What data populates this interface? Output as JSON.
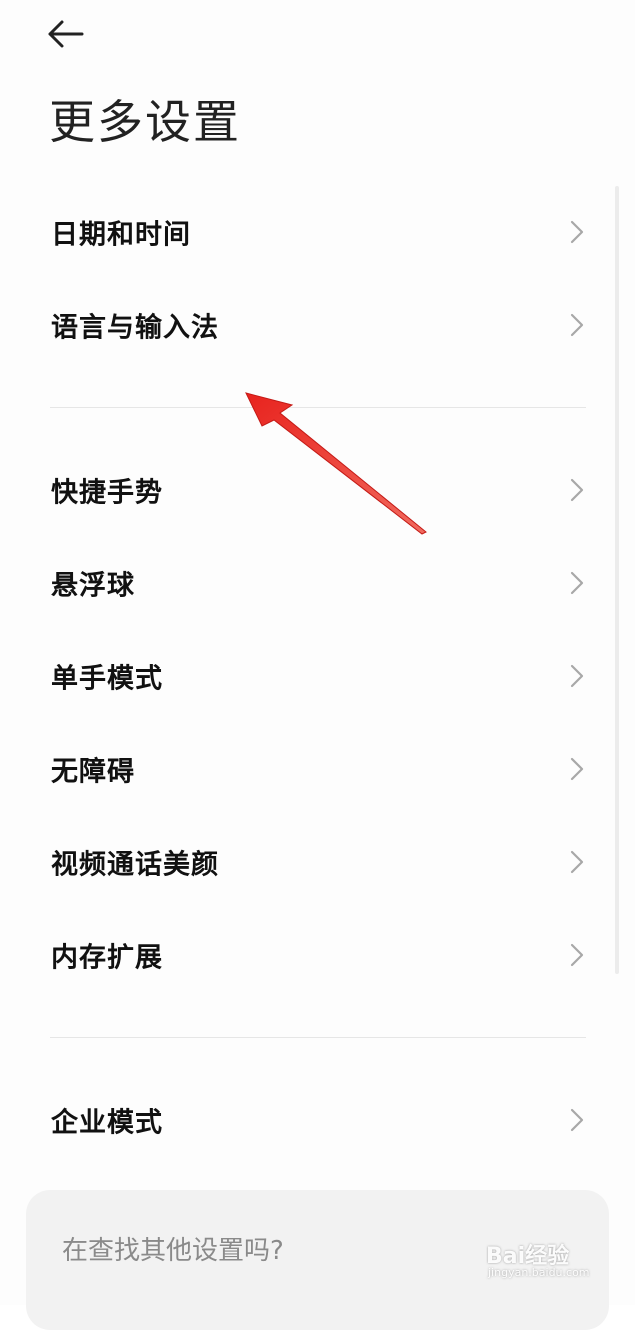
{
  "header": {
    "back_icon": "arrow-left-icon",
    "title": "更多设置"
  },
  "sections": [
    {
      "items": [
        {
          "label": "日期和时间"
        },
        {
          "label": "语言与输入法"
        }
      ]
    },
    {
      "items": [
        {
          "label": "快捷手势"
        },
        {
          "label": "悬浮球"
        },
        {
          "label": "单手模式"
        },
        {
          "label": "无障碍"
        },
        {
          "label": "视频通话美颜"
        },
        {
          "label": "内存扩展"
        }
      ]
    },
    {
      "items": [
        {
          "label": "企业模式"
        }
      ]
    }
  ],
  "search_card": {
    "text": "在查找其他设置吗?"
  },
  "annotation": {
    "type": "red-arrow",
    "color": "#e8231e"
  },
  "watermark": {
    "logo": "Bai经验",
    "sub": "jingyan.baidu.com"
  },
  "colors": {
    "background": "#fdfdfd",
    "text": "#111111",
    "chevron": "#a8a8a8",
    "divider": "#e6e6e6",
    "card": "#f2f2f2"
  }
}
